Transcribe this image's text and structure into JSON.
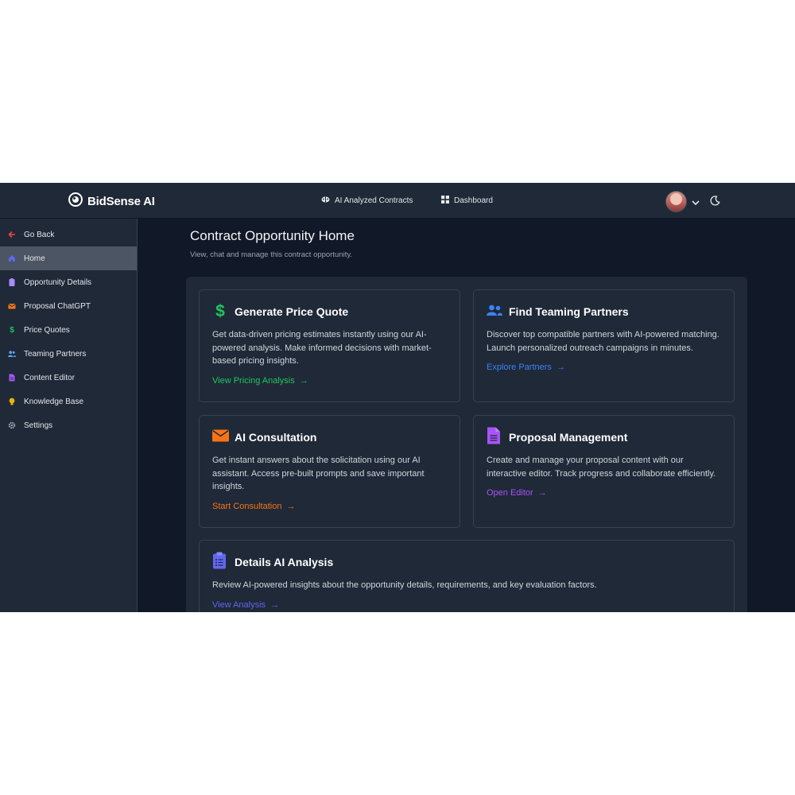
{
  "header": {
    "brand": "BidSense AI",
    "nav": [
      {
        "label": "AI Analyzed Contracts",
        "icon": "brain-icon"
      },
      {
        "label": "Dashboard",
        "icon": "grid-icon"
      }
    ]
  },
  "sidebar": {
    "items": [
      {
        "label": "Go Back",
        "icon": "arrow-left-icon",
        "color": "#ef4444"
      },
      {
        "label": "Home",
        "icon": "home-icon",
        "color": "#6366f1",
        "active": true
      },
      {
        "label": "Opportunity Details",
        "icon": "clipboard-icon",
        "color": "#a78bfa"
      },
      {
        "label": "Proposal ChatGPT",
        "icon": "envelope-icon",
        "color": "#f97316"
      },
      {
        "label": "Price Quotes",
        "icon": "dollar-icon",
        "color": "#22c55e"
      },
      {
        "label": "Teaming Partners",
        "icon": "users-icon",
        "color": "#60a5fa"
      },
      {
        "label": "Content Editor",
        "icon": "document-icon",
        "color": "#a855f7"
      },
      {
        "label": "Knowledge Base",
        "icon": "lightbulb-icon",
        "color": "#eab308"
      },
      {
        "label": "Settings",
        "icon": "gear-icon",
        "color": "#9ca3af"
      }
    ]
  },
  "main": {
    "title": "Contract Opportunity Home",
    "subtitle": "View, chat and manage this contract opportunity.",
    "cards": [
      {
        "title": "Generate Price Quote",
        "icon": "dollar-icon",
        "color": "#22c55e",
        "desc": "Get data-driven pricing estimates instantly using our AI-powered analysis. Make informed decisions with market-based pricing insights.",
        "link": "View Pricing Analysis",
        "arrow": "→"
      },
      {
        "title": "Find Teaming Partners",
        "icon": "users-icon",
        "color": "#3b82f6",
        "desc": "Discover top compatible partners with AI-powered matching. Launch personalized outreach campaigns in minutes.",
        "link": "Explore Partners",
        "arrow": "→"
      },
      {
        "title": "AI Consultation",
        "icon": "envelope-icon",
        "color": "#f97316",
        "desc": "Get instant answers about the solicitation using our AI assistant. Access pre-built prompts and save important insights.",
        "link": "Start Consultation",
        "arrow": "→"
      },
      {
        "title": "Proposal Management",
        "icon": "document-icon",
        "color": "#a855f7",
        "desc": "Create and manage your proposal content with our interactive editor. Track progress and collaborate efficiently.",
        "link": "Open Editor",
        "arrow": "→"
      },
      {
        "title": "Details AI Analysis",
        "icon": "clipboard-icon",
        "color": "#6366f1",
        "desc": "Review AI-powered insights about the opportunity details, requirements, and key evaluation factors.",
        "link": "View Analysis",
        "arrow": "→"
      }
    ]
  }
}
